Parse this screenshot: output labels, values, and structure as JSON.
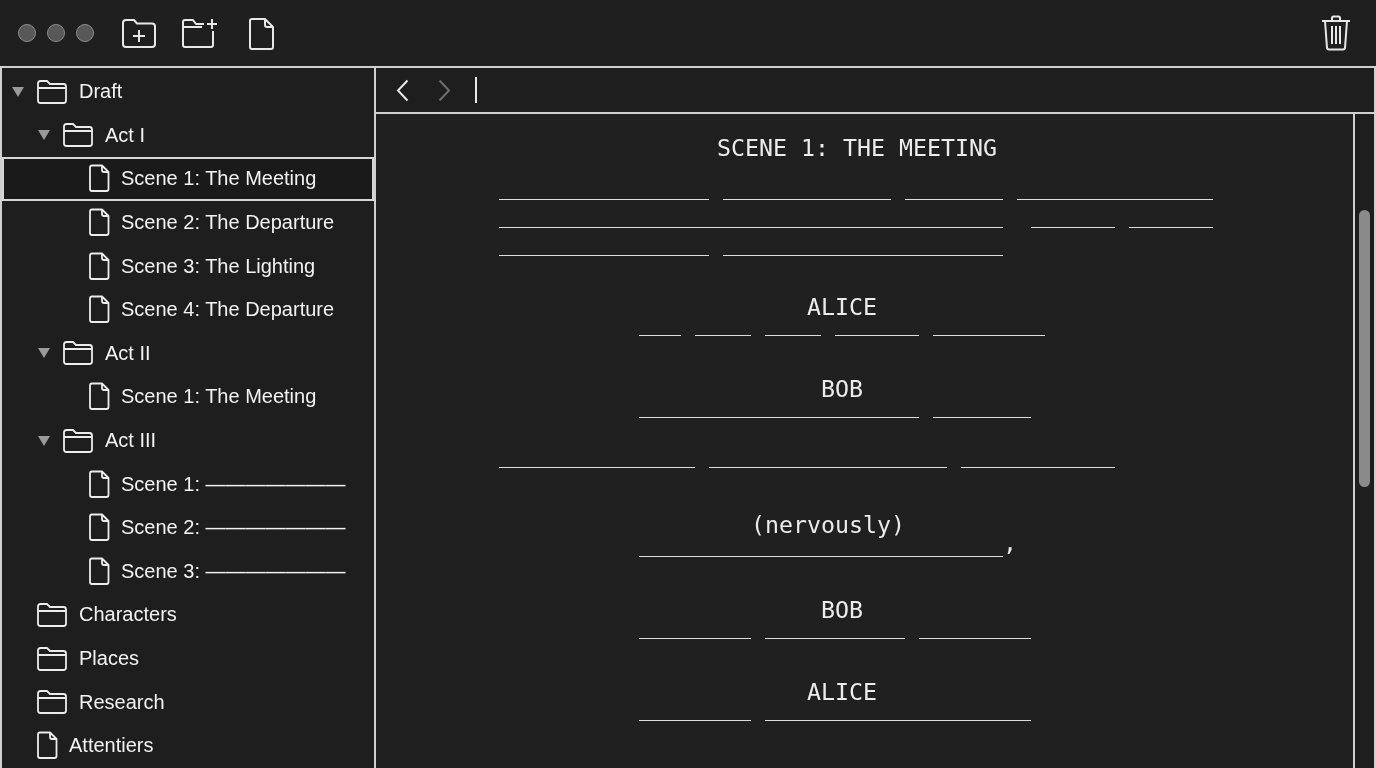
{
  "navigation": {
    "back": {
      "disabled": false
    },
    "forward": {
      "disabled": true
    }
  },
  "binder": {
    "items": [
      {
        "kind": "folder",
        "label": "Draft",
        "expanded": true,
        "selected": false,
        "children": [
          {
            "kind": "folder",
            "label": "Act I",
            "expanded": true,
            "selected": false,
            "children": [
              {
                "kind": "document",
                "label": "Scene 1: The Meeting",
                "selected": true
              },
              {
                "kind": "document",
                "label": "Scene 2: The Departure",
                "selected": false
              },
              {
                "kind": "document",
                "label": "Scene 3: The Lighting",
                "selected": false
              },
              {
                "kind": "document",
                "label": "Scene 4: The Departure",
                "selected": false
              }
            ]
          },
          {
            "kind": "folder",
            "label": "Act II",
            "expanded": true,
            "selected": false,
            "children": [
              {
                "kind": "document",
                "label": "Scene 1: The Meeting",
                "selected": false
              }
            ]
          },
          {
            "kind": "folder",
            "label": "Act III",
            "expanded": true,
            "selected": false,
            "children": [
              {
                "kind": "document",
                "label": "Scene 1: ———————",
                "selected": false
              },
              {
                "kind": "document",
                "label": "Scene 2: ———————",
                "selected": false
              },
              {
                "kind": "document",
                "label": "Scene 3: ———————",
                "selected": false
              }
            ]
          }
        ]
      },
      {
        "kind": "folder",
        "label": "Characters",
        "selected": false
      },
      {
        "kind": "folder",
        "label": "Places",
        "selected": false
      },
      {
        "kind": "folder",
        "label": "Research",
        "selected": false
      },
      {
        "kind": "document",
        "label": "Attentiers",
        "selected": false
      }
    ]
  },
  "editor": {
    "blocks": [
      {
        "kind": "heading",
        "text": "SCENE 1: THE MEETING"
      },
      {
        "kind": "action",
        "text": "_______________ ____________ _______ ______________ ____________________________________  ______ ______ _______________ ____________________"
      },
      {
        "kind": "character",
        "text": "ALICE"
      },
      {
        "kind": "dialogue",
        "text": "___ ____ ____ ______ ________"
      },
      {
        "kind": "character",
        "text": "BOB"
      },
      {
        "kind": "dialogue",
        "text": "____________________ _______"
      },
      {
        "kind": "action",
        "text": "______________ _________________ ___________"
      },
      {
        "kind": "parenthetical",
        "text": "(nervously)"
      },
      {
        "kind": "dialogue",
        "text": "__________________________,"
      },
      {
        "kind": "character",
        "text": "BOB"
      },
      {
        "kind": "dialogue",
        "text": "________ __________ ________"
      },
      {
        "kind": "character",
        "text": "ALICE"
      },
      {
        "kind": "dialogue",
        "text": "________ ___________________"
      }
    ]
  }
}
